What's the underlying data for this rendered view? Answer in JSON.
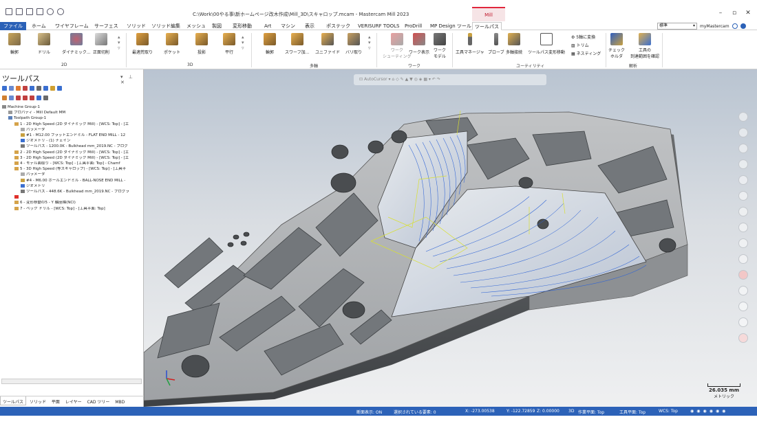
{
  "window": {
    "title": "C:\\Work\\00やる事\\新ホームページ改木作成\\Mill_3D\\スキャロップ.mcam - Mastercam Mill 2023",
    "context_tab": "Mill"
  },
  "tabs": [
    "ファイル",
    "ホーム",
    "ワイヤフレーム",
    "サーフェス",
    "ソリッド",
    "ソリッド編集",
    "メッシュ",
    "製図",
    "変形移動",
    "Art",
    "マシン",
    "表示",
    "ポステック",
    "VERISURF TOOLS",
    "ProDrill",
    "MP Design ツール",
    "ツールパス"
  ],
  "header_right": {
    "view_select": "標準",
    "user": "myMastercam"
  },
  "ribbon": {
    "groups": [
      "2D",
      "3D",
      "多軸",
      "ワーク",
      "ユーティリティ",
      "解析"
    ],
    "buttons": [
      "輪郭",
      "ドリル",
      "ダイナミック...",
      "正面切削",
      "最適荒取り",
      "ポケット",
      "投影",
      "平行",
      "輪郭",
      "スワーフ加...",
      "ユニファイド",
      "バリ取り",
      "ワーク\nシューティング",
      "ワーク表示",
      "ワーク\nモデル",
      "工具マネージャ",
      "プローブ",
      "多軸接続",
      "ツールパス変形移動",
      "チェック\nホルダ",
      "工具の\n到達範囲を確認"
    ],
    "small_buttons": [
      "5軸に変換",
      "トリム",
      "ネスティング"
    ]
  },
  "left_panel": {
    "title": "ツールパス",
    "tree": [
      {
        "text": "Machine Group-1",
        "level": 0,
        "color": "#888888"
      },
      {
        "text": "プロパティ - Mill Default MM",
        "level": 1,
        "color": "#999999"
      },
      {
        "text": "Toolpath Group-1",
        "level": 1,
        "color": "#5a7fb8"
      },
      {
        "text": "1 - 2D High Speed (2D ダイナミック Mill) - [WCS: Top] - [エ",
        "level": 2,
        "color": "#d5a34a"
      },
      {
        "text": "パラメータ",
        "level": 3,
        "color": "#aaaaaa"
      },
      {
        "text": "#1 - M12.00 フラットエンドミル - FLAT END MILL - 12",
        "level": 3,
        "color": "#c8a040"
      },
      {
        "text": "ジオメトリ - (1) チェイン",
        "level": 3,
        "color": "#3a6fd0"
      },
      {
        "text": "ツールパス - 1200.0K - Bulkhead mm_2019.NC - プログ",
        "level": 3,
        "color": "#777777"
      },
      {
        "text": "2 - 2D High Speed (2D ダイナミック Mill) - [WCS: Top] - [エ",
        "level": 2,
        "color": "#d5a34a"
      },
      {
        "text": "3 - 2D High Speed (2D ダイナミック Mill) - [WCS: Top] - [エ",
        "level": 2,
        "color": "#d5a34a"
      },
      {
        "text": "4 - モデル面取り - [WCS: Top] - [工具平面: Top] - Chamf",
        "level": 2,
        "color": "#d5a34a"
      },
      {
        "text": "5 - 3D High Speed (等スキャロップ) - [WCS: Top] - [工具平",
        "level": 2,
        "color": "#d5a34a"
      },
      {
        "text": "パラメータ",
        "level": 3,
        "color": "#aaaaaa"
      },
      {
        "text": "#4 - M6.00 ボールエンドミル - BALL-NOSE END MILL -",
        "level": 3,
        "color": "#c8a040"
      },
      {
        "text": "ジオメトリ",
        "level": 3,
        "color": "#3a6fd0"
      },
      {
        "text": "ツールパス - 448.6K - Bulkhead mm_2019.NC - プログラ",
        "level": 3,
        "color": "#777777"
      },
      {
        "text": "",
        "level": 2,
        "color": "#e0302a"
      },
      {
        "text": "6 - 変形移動の5 - Y 軸座標(NCI)",
        "level": 2,
        "color": "#d5a34a"
      },
      {
        "text": "7 - ペック ドリル - [WCS: Top] - [工具平面: Top]",
        "level": 2,
        "color": "#d5a34a"
      }
    ],
    "tabs": [
      "ツールパス",
      "ソリッド",
      "平面",
      "レイヤー",
      "CAD ツリー",
      "MBD"
    ]
  },
  "viewport": {
    "toolbar_label": "AutoCursor",
    "scale": {
      "value": "26.035 mm",
      "unit": "メトリック"
    },
    "colors": {
      "part": "#a9abad",
      "toolpath": "#2f64d6",
      "wire": "#d9e030"
    }
  },
  "status": {
    "section_view": "断面表示: ON",
    "selected": "選択されている要素: 0",
    "x": "X: -273.00538",
    "y": "Y: -122.72859",
    "z": "Z: 0.00000",
    "mode": "3D",
    "cplane": "作業平面: Top",
    "tplane": "工具平面: Top",
    "wcs": "WCS: Top"
  }
}
